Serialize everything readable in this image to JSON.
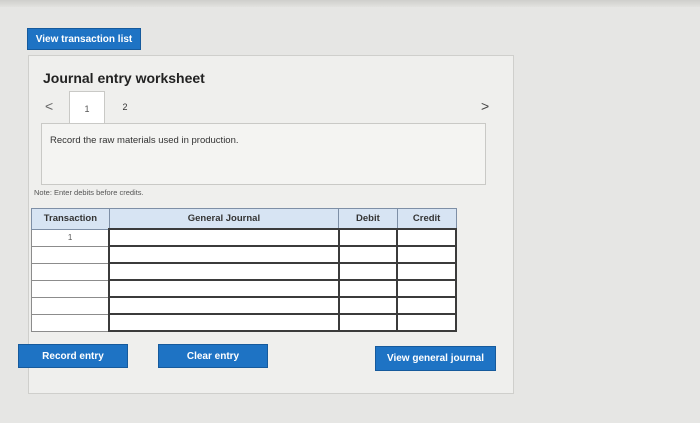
{
  "top_button": {
    "label": "View transaction list"
  },
  "worksheet": {
    "title": "Journal entry worksheet",
    "nav": {
      "prev_icon": "chevron-left-icon",
      "next_icon": "chevron-right-icon"
    },
    "tabs": [
      {
        "label": "1",
        "active": true
      },
      {
        "label": "2",
        "active": false
      }
    ],
    "description": "Record the raw materials used in production.",
    "note": "Note: Enter debits before credits.",
    "table": {
      "headers": [
        "Transaction",
        "General Journal",
        "Debit",
        "Credit"
      ],
      "rows": [
        {
          "transaction": "1",
          "account": "",
          "debit": "",
          "credit": ""
        },
        {
          "transaction": "",
          "account": "",
          "debit": "",
          "credit": ""
        },
        {
          "transaction": "",
          "account": "",
          "debit": "",
          "credit": ""
        },
        {
          "transaction": "",
          "account": "",
          "debit": "",
          "credit": ""
        },
        {
          "transaction": "",
          "account": "",
          "debit": "",
          "credit": ""
        },
        {
          "transaction": "",
          "account": "",
          "debit": "",
          "credit": ""
        }
      ]
    }
  },
  "actions": {
    "record_entry": "Record entry",
    "clear_entry": "Clear entry",
    "view_general_journal": "View general journal"
  },
  "colors": {
    "button": "#1e73c4",
    "header_fill": "#d7e4f3",
    "background": "#e6e6e4"
  }
}
